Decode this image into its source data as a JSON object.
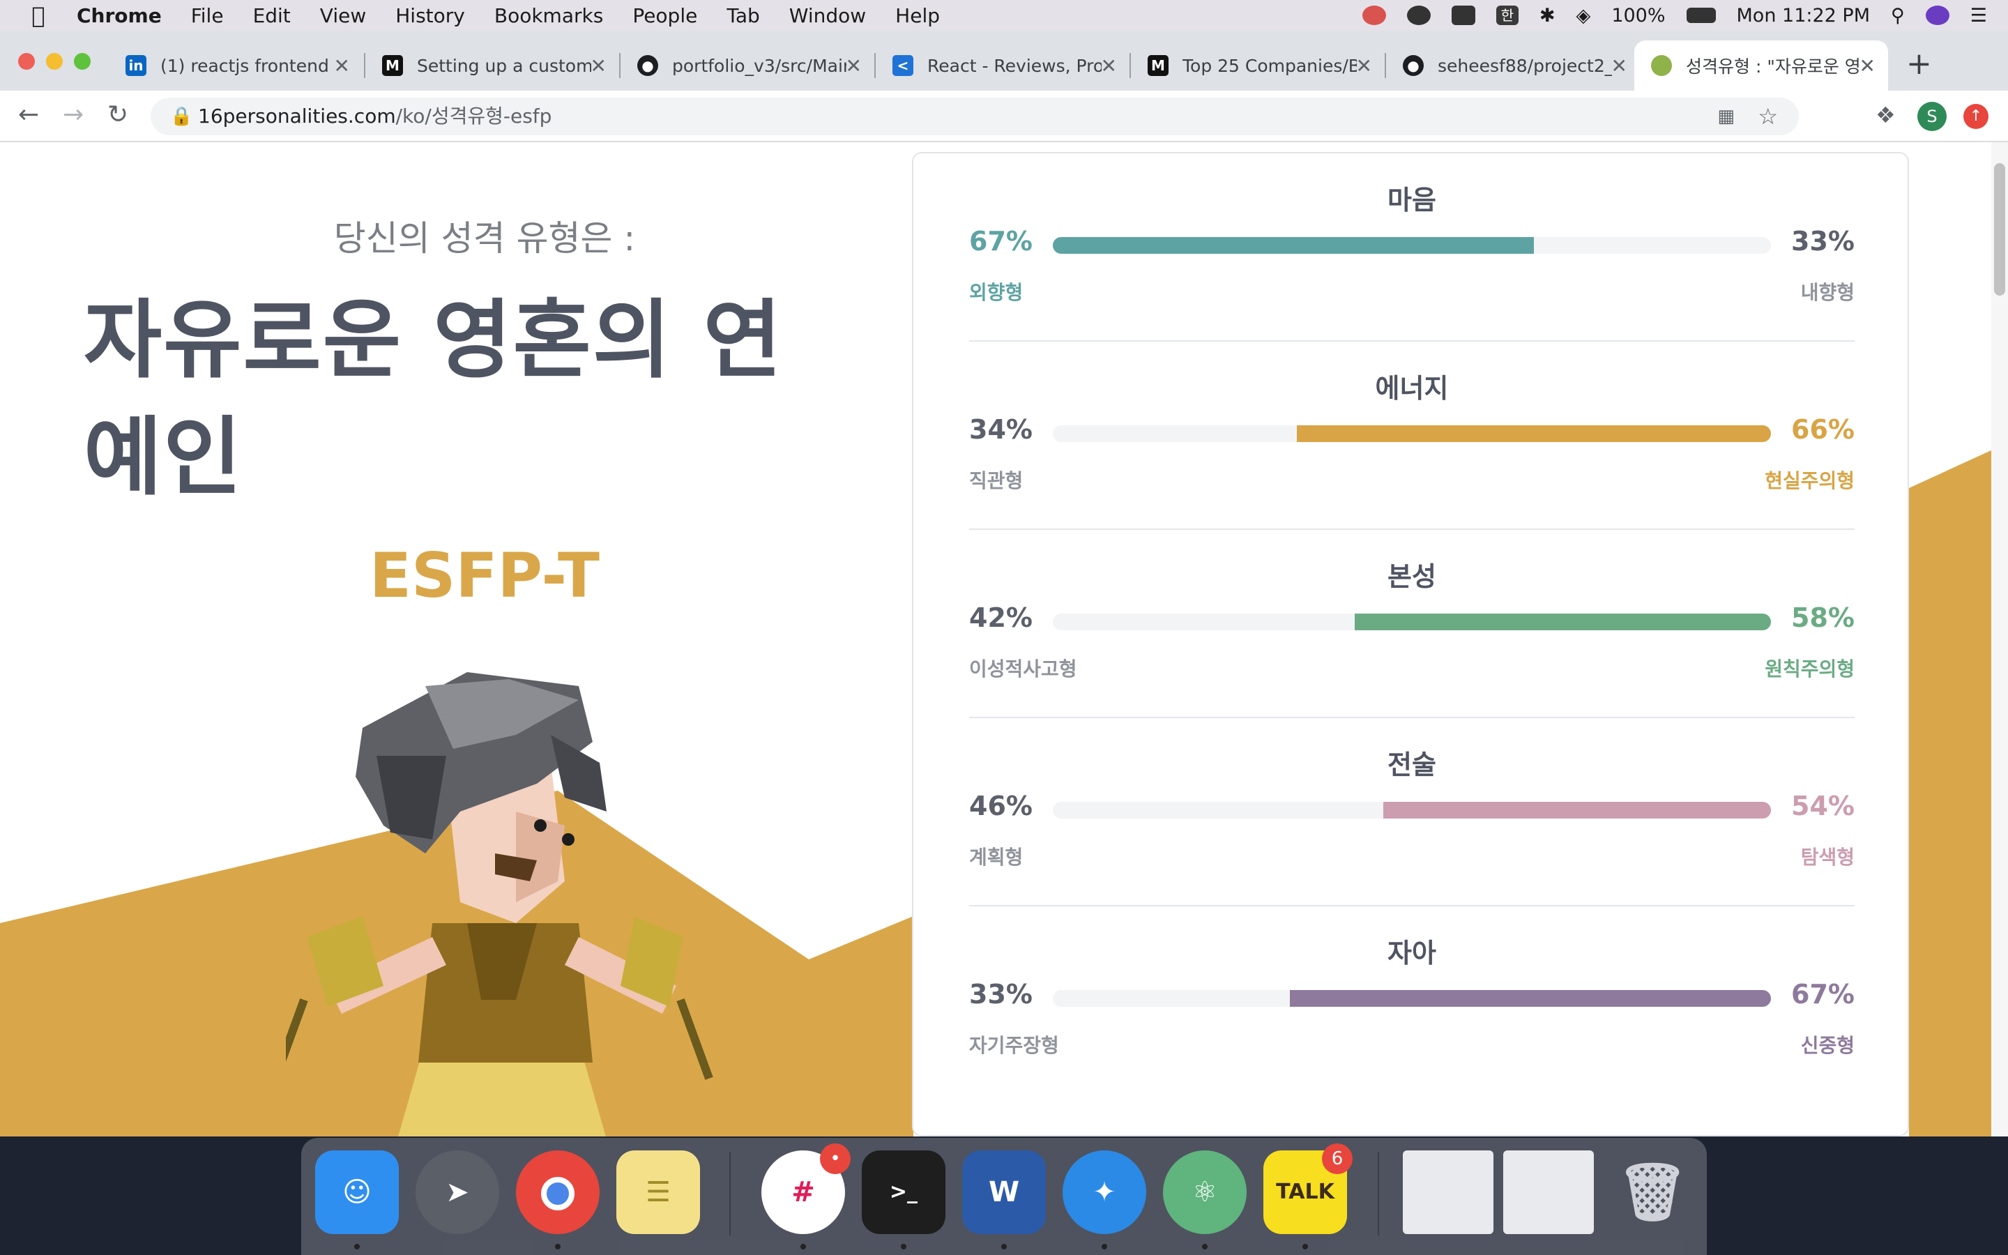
{
  "menubar": {
    "app_name": "Chrome",
    "items": [
      "File",
      "Edit",
      "View",
      "History",
      "Bookmarks",
      "People",
      "Tab",
      "Window",
      "Help"
    ],
    "battery": "100%",
    "clock": "Mon 11:22 PM"
  },
  "tabs": [
    {
      "title": "(1) reactjs frontend e",
      "icon": "linkedin-icon",
      "color": "#0a66c2"
    },
    {
      "title": "Setting up a custom",
      "icon": "medium-icon",
      "color": "#111111"
    },
    {
      "title": "portfolio_v3/src/Main",
      "icon": "github-icon",
      "color": "#1b1f23"
    },
    {
      "title": "React - Reviews, Pro",
      "icon": "share-icon",
      "color": "#1f72d6"
    },
    {
      "title": "Top 25 Companies/B",
      "icon": "medium-icon",
      "color": "#111111"
    },
    {
      "title": "seheesf88/project2_",
      "icon": "github-icon",
      "color": "#1b1f23"
    },
    {
      "title": "성격유형 : \"자유로운 영",
      "icon": "16personalities-icon",
      "color": "#8fb24a",
      "active": true
    }
  ],
  "toolbar": {
    "url_host": "16personalities.com",
    "url_path": "/ko/성격유형-esfp",
    "avatar_letter": "S"
  },
  "hero": {
    "subtitle": "당신의 성격 유형은 :",
    "type_name": "자유로운 영혼의 연예인",
    "type_code": "ESFP-T"
  },
  "traits": [
    {
      "title": "마음",
      "left_pct": "67%",
      "right_pct": "33%",
      "left_label": "외향형",
      "right_label": "내향형",
      "dominant": "left",
      "fill_start": 0,
      "fill_end": 0.67,
      "color": "#5ea3a3"
    },
    {
      "title": "에너지",
      "left_pct": "34%",
      "right_pct": "66%",
      "left_label": "직관형",
      "right_label": "현실주의형",
      "dominant": "right",
      "fill_start": 0.34,
      "fill_end": 1,
      "color": "#d9a445"
    },
    {
      "title": "본성",
      "left_pct": "42%",
      "right_pct": "58%",
      "left_label": "이성적사고형",
      "right_label": "원칙주의형",
      "dominant": "right",
      "fill_start": 0.42,
      "fill_end": 1,
      "color": "#6bab84"
    },
    {
      "title": "전술",
      "left_pct": "46%",
      "right_pct": "54%",
      "left_label": "계획형",
      "right_label": "탐색형",
      "dominant": "right",
      "fill_start": 0.46,
      "fill_end": 1,
      "color": "#cc9daf"
    },
    {
      "title": "자아",
      "left_pct": "33%",
      "right_pct": "67%",
      "left_label": "자기주장형",
      "right_label": "신중형",
      "dominant": "right",
      "fill_start": 0.33,
      "fill_end": 1,
      "color": "#8e7a9c"
    }
  ],
  "dock": {
    "apps": [
      {
        "name": "finder-icon",
        "color": "#2f8ff0",
        "running": true
      },
      {
        "name": "launchpad-icon",
        "color": "#5a5f68",
        "running": false
      },
      {
        "name": "chrome-icon",
        "color": "#e8453c",
        "running": true
      },
      {
        "name": "notes-icon",
        "color": "#f5e08a",
        "running": false
      },
      {
        "name": "slack-icon",
        "color": "#ffffff",
        "running": true,
        "badge": "•"
      },
      {
        "name": "terminal-icon",
        "color": "#1e1e1e",
        "running": true,
        "glyph": ">_"
      },
      {
        "name": "word-icon",
        "color": "#2b5aa8",
        "running": true,
        "glyph": "W"
      },
      {
        "name": "safari-icon",
        "color": "#2b8ae6",
        "running": true
      },
      {
        "name": "atom-icon",
        "color": "#5fb57d",
        "running": true
      },
      {
        "name": "kakaotalk-icon",
        "color": "#f7de1e",
        "running": true,
        "glyph": "TALK",
        "badge": "6"
      }
    ]
  }
}
